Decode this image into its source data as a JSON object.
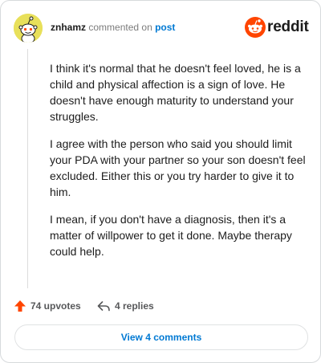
{
  "header": {
    "username": "znhamz",
    "verb": "commented on",
    "target": "post",
    "brand": "reddit"
  },
  "comment": {
    "paragraphs": [
      "I think it's normal that he doesn't feel loved, he is a child and physical affection is a sign of love. He doesn't have enough maturity to understand your struggles.",
      "I agree with the person who said you should limit your PDA with your partner so your son doesn't feel excluded. Either this or you try harder to give it to him.",
      "I mean, if you don't have a diagnosis, then it's a matter of willpower to get it done. Maybe therapy could help."
    ]
  },
  "actions": {
    "upvotes_label": "74 upvotes",
    "replies_label": "4 replies"
  },
  "footer": {
    "view_comments_label": "View 4 comments"
  },
  "colors": {
    "accent": "#0079d3",
    "upvote": "#ff4500",
    "brand": "#ff4500",
    "avatar_bg": "#e8e05a"
  },
  "icons": {
    "avatar": "snoo-avatar-icon",
    "logo": "reddit-snoo-icon",
    "upvote": "upvote-arrow-icon",
    "reply": "reply-arrow-icon"
  }
}
